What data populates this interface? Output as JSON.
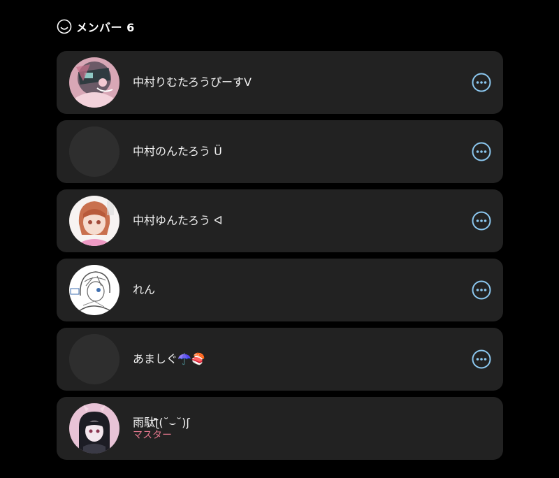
{
  "header": {
    "icon": "smile-icon",
    "title": "メンバー 6"
  },
  "colors": {
    "background": "#000000",
    "card": "#222222",
    "accent": "#8cc8f0",
    "role": "#e2768c"
  },
  "members": [
    {
      "name": "中村りむたろうぴーすV",
      "avatar": "anime-avatar-pink-icon",
      "role": "",
      "has_menu": true
    },
    {
      "name": "中村のんたろう Ü",
      "avatar": "blank-avatar-icon",
      "role": "",
      "has_menu": true
    },
    {
      "name": "中村ゆんたろう ᐊ",
      "avatar": "anime-avatar-red-hair-icon",
      "role": "",
      "has_menu": true
    },
    {
      "name": "れん",
      "avatar": "anime-avatar-sketch-icon",
      "role": "",
      "has_menu": true
    },
    {
      "name": "あましぐ☂️🍣",
      "avatar": "blank-avatar-icon",
      "role": "",
      "has_menu": true
    },
    {
      "name": "雨駄ƪ(˘⌣˘)ʃ",
      "avatar": "anime-avatar-bunny-icon",
      "role": "マスター",
      "has_menu": false
    }
  ],
  "more_icon": "more-options-icon"
}
